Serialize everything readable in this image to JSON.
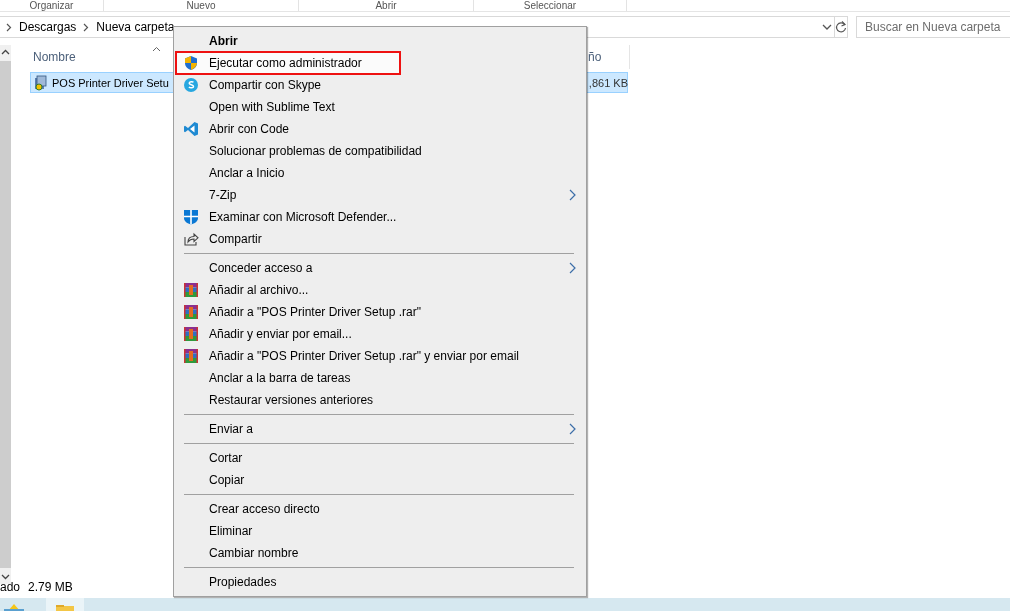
{
  "ribbon": {
    "groups": [
      "Organizar",
      "Nuevo",
      "Abrir",
      "Seleccionar"
    ]
  },
  "address_bar": {
    "path": [
      "Descargas",
      "Nueva carpeta"
    ],
    "search": {
      "placeholder": "Buscar en Nueva carpeta"
    }
  },
  "file_list": {
    "columns": [
      "Nombre",
      "ño"
    ],
    "rows": [
      {
        "name": "POS Printer Driver Setu",
        "size": ",861 KB",
        "selected": true
      }
    ]
  },
  "status_bar": {
    "text": "ado",
    "size": "2.79 MB"
  },
  "context_menu": {
    "items": [
      {
        "kind": "plain",
        "label": "Abrir",
        "bold": true,
        "selected": false,
        "outlined": false,
        "submenu": false
      },
      {
        "kind": "shield",
        "label": "Ejecutar como administrador",
        "bold": false,
        "selected": true,
        "outlined": true,
        "submenu": false
      },
      {
        "kind": "skype",
        "label": "Compartir con Skype",
        "bold": false,
        "selected": false,
        "outlined": false,
        "submenu": false
      },
      {
        "kind": "plain",
        "label": "Open with Sublime Text",
        "bold": false,
        "selected": false,
        "outlined": false,
        "submenu": false
      },
      {
        "kind": "vscode",
        "label": "Abrir con Code",
        "bold": false,
        "selected": false,
        "outlined": false,
        "submenu": false
      },
      {
        "kind": "plain",
        "label": "Solucionar problemas de compatibilidad",
        "bold": false,
        "selected": false,
        "outlined": false,
        "submenu": false
      },
      {
        "kind": "plain",
        "label": "Anclar a Inicio",
        "bold": false,
        "selected": false,
        "outlined": false,
        "submenu": false
      },
      {
        "kind": "plain",
        "label": "7-Zip",
        "bold": false,
        "selected": false,
        "outlined": false,
        "submenu": true
      },
      {
        "kind": "defender",
        "label": "Examinar con Microsoft Defender...",
        "bold": false,
        "selected": false,
        "outlined": false,
        "submenu": false
      },
      {
        "kind": "share",
        "label": "Compartir",
        "bold": false,
        "selected": false,
        "outlined": false,
        "submenu": false
      },
      {
        "kind": "separator"
      },
      {
        "kind": "plain",
        "label": "Conceder acceso a",
        "bold": false,
        "selected": false,
        "outlined": false,
        "submenu": true
      },
      {
        "kind": "winrar",
        "label": "Añadir al archivo...",
        "bold": false,
        "selected": false,
        "outlined": false,
        "submenu": false
      },
      {
        "kind": "winrar",
        "label": "Añadir a \"POS Printer Driver Setup .rar\"",
        "bold": false,
        "selected": false,
        "outlined": false,
        "submenu": false
      },
      {
        "kind": "winrar",
        "label": "Añadir y enviar por email...",
        "bold": false,
        "selected": false,
        "outlined": false,
        "submenu": false
      },
      {
        "kind": "winrar",
        "label": "Añadir a \"POS Printer Driver Setup .rar\" y enviar por email",
        "bold": false,
        "selected": false,
        "outlined": false,
        "submenu": false
      },
      {
        "kind": "plain",
        "label": "Anclar a la barra de tareas",
        "bold": false,
        "selected": false,
        "outlined": false,
        "submenu": false
      },
      {
        "kind": "plain",
        "label": "Restaurar versiones anteriores",
        "bold": false,
        "selected": false,
        "outlined": false,
        "submenu": false
      },
      {
        "kind": "separator"
      },
      {
        "kind": "plain",
        "label": "Enviar a",
        "bold": false,
        "selected": false,
        "outlined": false,
        "submenu": true
      },
      {
        "kind": "separator"
      },
      {
        "kind": "plain",
        "label": "Cortar",
        "bold": false,
        "selected": false,
        "outlined": false,
        "submenu": false
      },
      {
        "kind": "plain",
        "label": "Copiar",
        "bold": false,
        "selected": false,
        "outlined": false,
        "submenu": false
      },
      {
        "kind": "separator"
      },
      {
        "kind": "plain",
        "label": "Crear acceso directo",
        "bold": false,
        "selected": false,
        "outlined": false,
        "submenu": false
      },
      {
        "kind": "plain",
        "label": "Eliminar",
        "bold": false,
        "selected": false,
        "outlined": false,
        "submenu": false
      },
      {
        "kind": "plain",
        "label": "Cambiar nombre",
        "bold": false,
        "selected": false,
        "outlined": false,
        "submenu": false
      },
      {
        "kind": "separator"
      },
      {
        "kind": "plain",
        "label": "Propiedades",
        "bold": false,
        "selected": false,
        "outlined": false,
        "submenu": false
      }
    ]
  }
}
